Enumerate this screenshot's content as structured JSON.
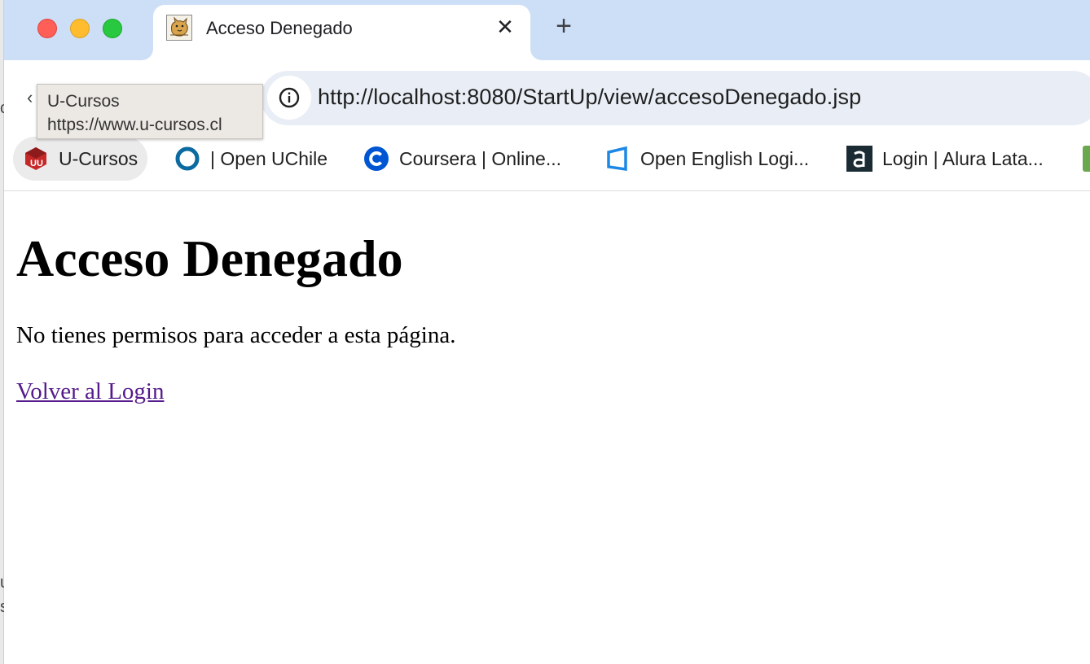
{
  "browser": {
    "tab": {
      "title": "Acceso Denegado",
      "close_symbol": "✕",
      "favicon": "tomcat-icon"
    },
    "new_tab_symbol": "+",
    "toolbar": {
      "back_symbol": "‹",
      "url": "http://localhost:8080/StartUp/view/accesoDenegado.jsp"
    },
    "bookmarks": [
      {
        "label": "U-Cursos",
        "icon": "ucursos-icon",
        "color": "#c62828"
      },
      {
        "label": "| Open UChile",
        "icon": "ring-icon",
        "color": "#0a6aa1"
      },
      {
        "label": "Coursera | Online...",
        "icon": "coursera-icon",
        "color": "#0056d2"
      },
      {
        "label": "Open English Logi...",
        "icon": "open-english-icon",
        "color": "#1e88e5"
      },
      {
        "label": "Login | Alura Lata...",
        "icon": "alura-icon",
        "color": "#1b2b34"
      },
      {
        "label": "",
        "icon": "green-square-icon",
        "color": "#6aa84f"
      }
    ],
    "tooltip": {
      "title": "U-Cursos",
      "url": "https://www.u-cursos.cl"
    }
  },
  "page": {
    "heading": "Acceso Denegado",
    "message": "No tienes permisos para acceder a esta página.",
    "link": "Volver al Login"
  }
}
